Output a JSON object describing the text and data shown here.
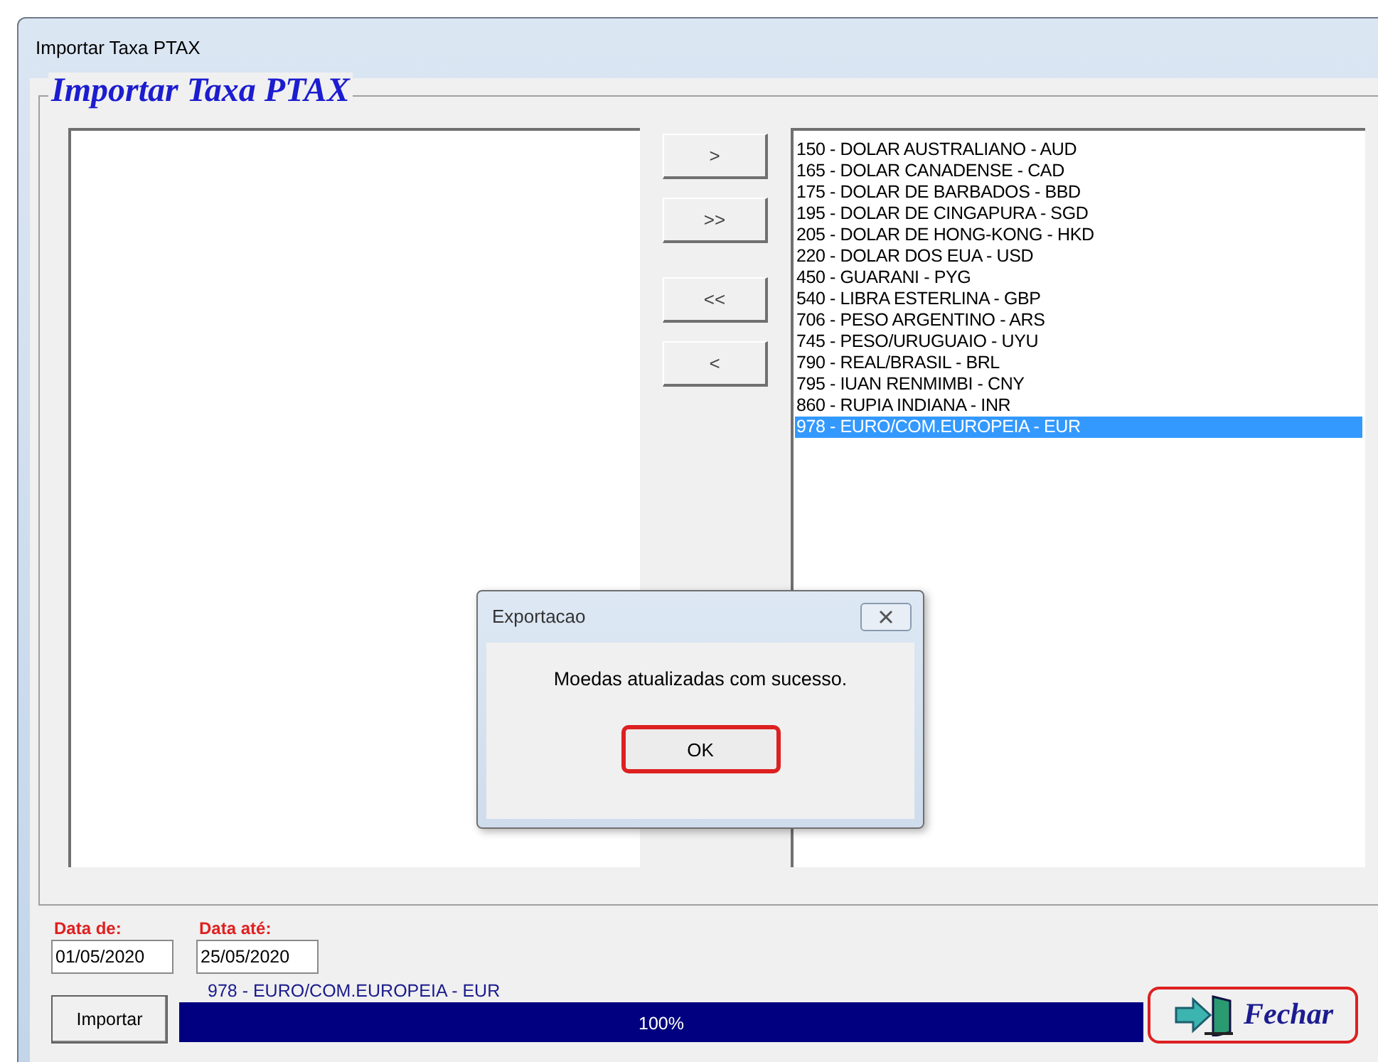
{
  "window": {
    "title": "Importar Taxa PTAX"
  },
  "group": {
    "title": "Importar Taxa PTAX"
  },
  "transfer_buttons": [
    ">",
    ">>",
    "<<",
    "<"
  ],
  "selected_list": [
    {
      "label": "150 - DOLAR AUSTRALIANO - AUD",
      "selected": false
    },
    {
      "label": "165 - DOLAR CANADENSE - CAD",
      "selected": false
    },
    {
      "label": "175 - DOLAR DE BARBADOS - BBD",
      "selected": false
    },
    {
      "label": "195 - DOLAR DE CINGAPURA - SGD",
      "selected": false
    },
    {
      "label": "205 - DOLAR DE HONG-KONG - HKD",
      "selected": false
    },
    {
      "label": "220 - DOLAR DOS EUA - USD",
      "selected": false
    },
    {
      "label": "450 - GUARANI - PYG",
      "selected": false
    },
    {
      "label": "540 - LIBRA ESTERLINA - GBP",
      "selected": false
    },
    {
      "label": "706 - PESO ARGENTINO - ARS",
      "selected": false
    },
    {
      "label": "745 - PESO/URUGUAIO - UYU",
      "selected": false
    },
    {
      "label": "790 - REAL/BRASIL - BRL",
      "selected": false
    },
    {
      "label": "795 - IUAN RENMIMBI - CNY",
      "selected": false
    },
    {
      "label": "860 - RUPIA INDIANA - INR",
      "selected": false
    },
    {
      "label": "978 - EURO/COM.EUROPEIA - EUR",
      "selected": true
    }
  ],
  "dialog": {
    "title": "Exportacao",
    "message": "Moedas atualizadas com sucesso.",
    "ok_button": {
      "label": "OK",
      "highlighted": true
    }
  },
  "date_from": {
    "label": "Data de:",
    "value": "01/05/2020"
  },
  "date_to": {
    "label": "Data até:",
    "value": "25/05/2020"
  },
  "import_button": "Importar",
  "progress": {
    "current": "978 - EURO/COM.EUROPEIA - EUR",
    "level": 1,
    "reading": "100%"
  },
  "close_button": {
    "label": "Fechar",
    "highlighted": true
  }
}
